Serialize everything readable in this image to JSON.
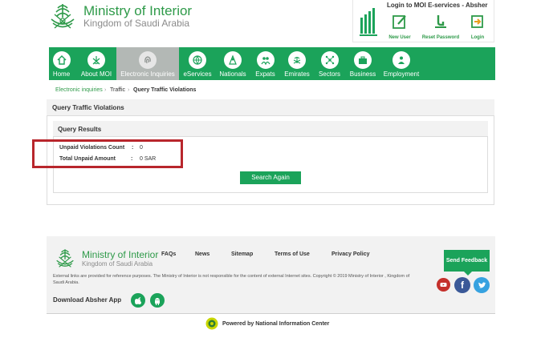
{
  "header": {
    "title": "Ministry of Interior",
    "subtitle": "Kingdom of Saudi Arabia",
    "login_title": "Login to MOI E-services - Absher",
    "login_buttons": [
      "New User",
      "Reset Password",
      "Login"
    ]
  },
  "nav": {
    "items": [
      "Home",
      "About MOI",
      "Electronic Inquiries",
      "eServices",
      "Nationals",
      "Expats",
      "Emirates",
      "Sectors",
      "Business",
      "Employment"
    ],
    "active": "Electronic Inquiries"
  },
  "breadcrumb": [
    "Electronic inquiries",
    "Traffic",
    "Query Traffic Violations"
  ],
  "panel": {
    "title": "Query Traffic Violations",
    "results_title": "Query Results",
    "rows": [
      {
        "label": "Unpaid Violations Count",
        "colon": ":",
        "value": "0"
      },
      {
        "label": "Total Unpaid Amount",
        "colon": ":",
        "value": "0 SAR"
      }
    ],
    "search_again": "Search Again"
  },
  "footer": {
    "title": "Ministry of Interior",
    "subtitle": "Kingdom of Saudi Arabia",
    "links": [
      "FAQs",
      "News",
      "Sitemap",
      "Terms of Use",
      "Privacy Policy"
    ],
    "disclaimer": "External links are provided for reference purposes. The Ministry of Interior is not responsible for the content of external Internet sites. Copyright © 2019 Ministry of Interior , Kingdom of Saudi Arabia.",
    "download_label": "Download Absher App",
    "send_feedback": "Send Feedback",
    "social_icons": [
      "youtube-icon",
      "facebook-icon",
      "twitter-icon"
    ],
    "powered_by": "Powered by National Information Center"
  },
  "colors": {
    "brand_green": "#1ba35a",
    "active_tab": "#b3b8b5",
    "highlight_red": "#b8262c"
  }
}
